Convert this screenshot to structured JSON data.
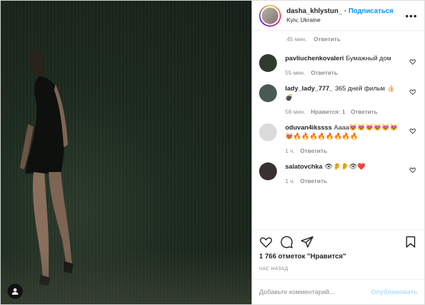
{
  "post": {
    "username": "dasha_khlystun_",
    "separator": "•",
    "follow_label": "Подписаться",
    "location": "Kyiv, Ukraine",
    "more_label": "•••"
  },
  "comments_panel": {
    "top_meta": {
      "time": "45 мин.",
      "reply": "Ответить"
    },
    "items": [
      {
        "username": "pavliuchenkovaleri",
        "text": "Бумажный дом",
        "time": "55 мин.",
        "likes": "",
        "reply": "Ответить",
        "avatar_color": "#2f3b2f"
      },
      {
        "username": "lady_lady_777_",
        "text": "365 дней фильм 👍🏻💣",
        "time": "56 мин.",
        "likes": "Нравится: 1",
        "reply": "Ответить",
        "avatar_color": "#4a5a52"
      },
      {
        "username": "oduvan4ikssss",
        "text": "Аааа😻😻😻😻😻😻😻🔥🔥🔥🔥🔥🔥🔥🔥",
        "time": "1 ч.",
        "likes": "",
        "reply": "Ответить",
        "avatar_color": "#dbdbdb"
      },
      {
        "username": "salatovchka",
        "text": "👁👂👂👁❤️",
        "time": "1 ч.",
        "likes": "",
        "reply": "Ответить",
        "avatar_color": "#3a3030"
      }
    ]
  },
  "actions": {
    "like_icon": "heart-icon",
    "comment_icon": "comment-icon",
    "share_icon": "paper-plane-icon",
    "save_icon": "bookmark-icon"
  },
  "likes_text": "1 766 отметок \"Нравится\"",
  "time_ago": "ЧАС НАЗАД",
  "add_comment": {
    "placeholder": "Добавьте комментарий...",
    "value": "",
    "publish_label": "Опубликовать"
  },
  "colors": {
    "accent": "#0095f6",
    "publish_disabled": "#b2dffc",
    "muted": "#8e8e8e"
  }
}
